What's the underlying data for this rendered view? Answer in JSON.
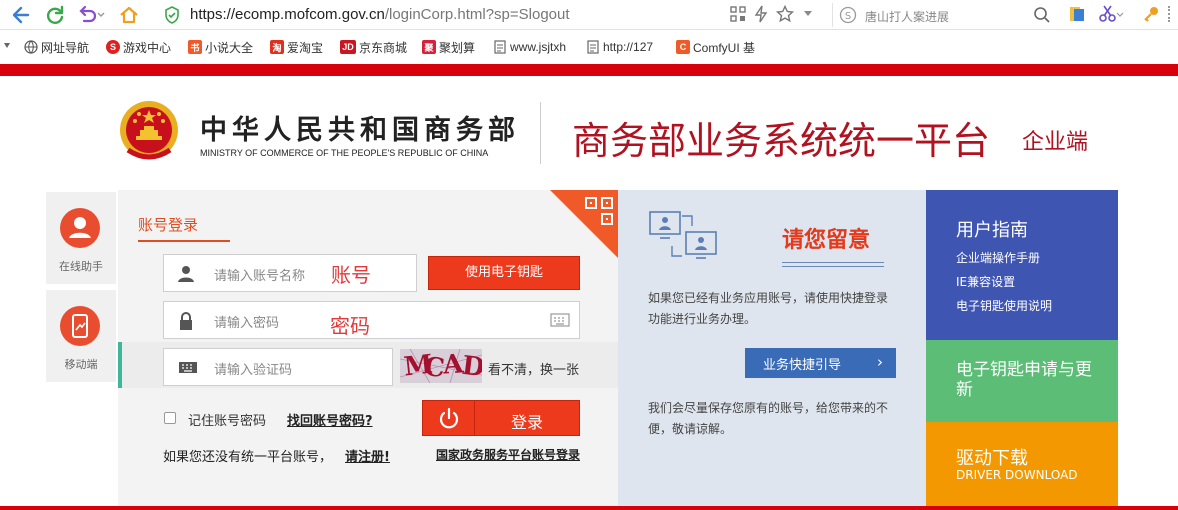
{
  "browser": {
    "url_host": "https://ecomp.mofcom.gov.cn",
    "url_path": "/loginCorp.html?sp=Slogout",
    "search_text": "唐山打人案进展"
  },
  "bookmarks": [
    {
      "label": "网址导航",
      "icon": "globe-icon"
    },
    {
      "label": "游戏中心",
      "icon": "game-icon",
      "color": "#e02020"
    },
    {
      "label": "小说大全",
      "icon": "novel-icon",
      "color": "#f05a28"
    },
    {
      "label": "爱淘宝",
      "icon": "taobao-icon",
      "color": "#e0301e"
    },
    {
      "label": "京东商城",
      "icon": "jd-icon",
      "color": "#c91623"
    },
    {
      "label": "聚划算",
      "icon": "juhuasuan-icon",
      "color": "#d8203a"
    },
    {
      "label": "www.jsjtxh",
      "icon": "page-icon"
    },
    {
      "label": "http://127",
      "icon": "page-icon"
    },
    {
      "label": "ComfyUI 基",
      "icon": "comfy-icon",
      "color": "#f05a28"
    }
  ],
  "header": {
    "ministry_cn": "中华人民共和国商务部",
    "ministry_en": "MINISTRY OF COMMERCE OF THE PEOPLE'S REPUBLIC OF CHINA",
    "platform_title": "商务部业务系统统一平台",
    "platform_sub": "企业端"
  },
  "side_helpers": {
    "online": "在线助手",
    "mobile": "移动端"
  },
  "login": {
    "tab": "账号登录",
    "account_placeholder": "请输入账号名称",
    "account_annotation": "账号",
    "ekey_button": "使用电子钥匙",
    "password_placeholder": "请输入密码",
    "password_annotation": "密码",
    "captcha_placeholder": "请输入验证码",
    "captcha_code": [
      "M",
      "C",
      "A",
      "D"
    ],
    "captcha_refresh": "看不清，换一张",
    "remember": "记住账号密码",
    "forgot": "找回账号密码?",
    "login_button": "登录",
    "no_account": "如果您还没有统一平台账号，",
    "register": "请注册!",
    "gov_login": "国家政务服务平台账号登录"
  },
  "notice": {
    "title": "请您留意",
    "text1": "如果您已经有业务应用账号，请使用快捷登录功能进行业务办理。",
    "guide_button": "业务快捷引导",
    "text2": "我们会尽量保存您原有的账号，给您带来的不便，敬请谅解。"
  },
  "tiles": {
    "guide_title": "用户指南",
    "guide_links": [
      "企业端操作手册",
      "IE兼容设置",
      "电子钥匙使用说明"
    ],
    "key_title": "电子钥匙申请与更新",
    "driver_title": "驱动下载",
    "driver_sub": "DRIVER DOWNLOAD"
  },
  "colors": {
    "brand_red": "#d8000b",
    "title_red": "#b01220",
    "login_button": "#ee3a1c",
    "guide_tile": "#3f55b2",
    "key_tile": "#5cbd76",
    "driver_tile": "#f39800",
    "notice_bg": "#dfe5ee"
  }
}
